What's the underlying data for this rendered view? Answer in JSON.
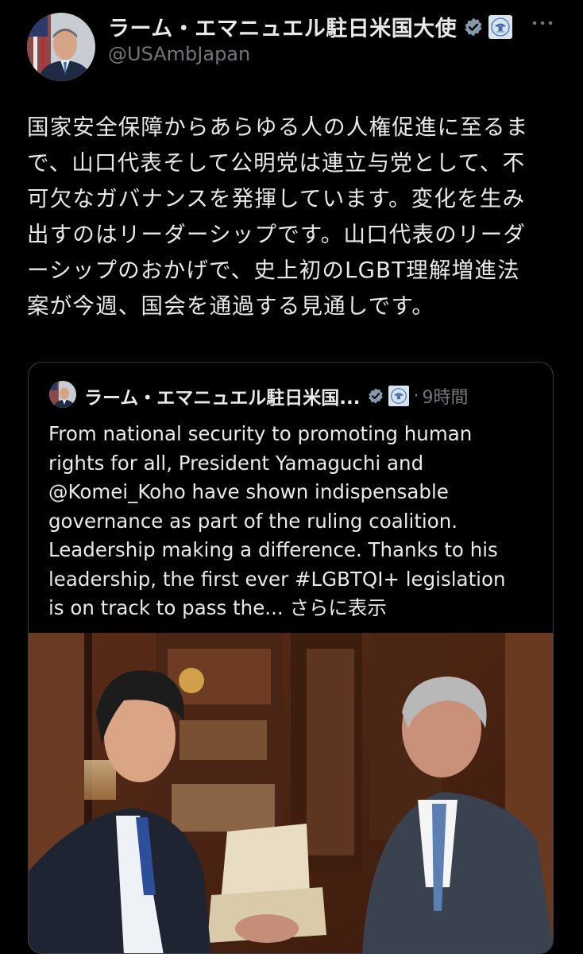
{
  "author": {
    "display_name": "ラーム・エマニュエル駐日米国大使",
    "handle": "@USAmbJapan"
  },
  "tweet": {
    "text": "国家安全保障からあらゆる人の人権促進に至るま\nで、山口代表そして公明党は連立与党として、不\n可欠なガバナンスを発揮しています。変化を生み\n出すのはリーダーシップです。山口代表のリーダ\nーシップのおかげで、史上初のLGBT理解増進法\n案が今週、国会を通過する見通しです。"
  },
  "quote": {
    "display_name": "ラーム・エマニュエル駐日米国...",
    "dot": "·",
    "time": "9時間",
    "text": "From national security to promoting human\nrights for all, President Yamaguchi and\n@Komei_Koho have shown indispensable\ngovernance as part of the ruling coalition.\nLeadership making a difference. Thanks to his\nleadership, the first ever #LGBTQI+ legislation\nis on track to pass the... ",
    "show_more": "さらに表示"
  },
  "icons": {
    "verified": "verified-badge-icon",
    "gov": "government-seal-icon",
    "more": "more-options-icon"
  },
  "colors": {
    "background": "#000000",
    "text": "#e7e9ea",
    "muted": "#71767b",
    "verified_badge": "#829aab",
    "border": "#3b3f44"
  }
}
